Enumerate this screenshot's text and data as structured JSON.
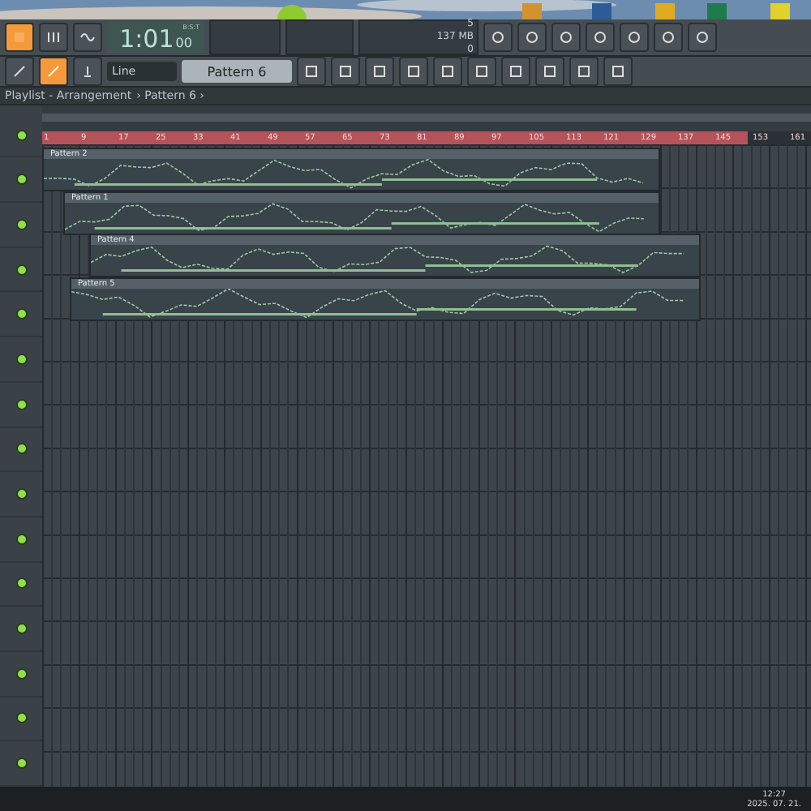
{
  "toolbar": {
    "time": "1:01",
    "time_small": "00",
    "time_label": "B:S:T",
    "cpu": "5",
    "memory": "137 MB",
    "polyphony": "0",
    "snap": "Line",
    "pattern": "Pattern 6"
  },
  "playlist": {
    "title": "Playlist - Arrangement",
    "breadcrumb": "› Pattern 6 ›",
    "ruler": [
      "1",
      "9",
      "17",
      "25",
      "33",
      "41",
      "49",
      "57",
      "65",
      "73",
      "81",
      "89",
      "97",
      "105",
      "113",
      "121",
      "129",
      "137",
      "145",
      "153",
      "161"
    ],
    "tracks": [
      {
        "enabled": true
      },
      {
        "enabled": true
      },
      {
        "enabled": true
      },
      {
        "enabled": true
      },
      {
        "enabled": true
      },
      {
        "enabled": true
      },
      {
        "enabled": true
      },
      {
        "enabled": true
      },
      {
        "enabled": true
      },
      {
        "enabled": true
      },
      {
        "enabled": true
      },
      {
        "enabled": true
      },
      {
        "enabled": true
      },
      {
        "enabled": true
      },
      {
        "enabled": true
      }
    ],
    "clips": [
      {
        "label": "Pattern 2"
      },
      {
        "label": "Pattern 1"
      },
      {
        "label": "Pattern 4"
      },
      {
        "label": "Pattern 5"
      }
    ]
  },
  "taskbar": {
    "time": "12:27",
    "date": "2025. 07. 21."
  }
}
